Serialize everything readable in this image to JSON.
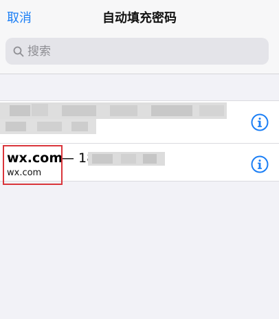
{
  "navbar": {
    "cancel_label": "取消",
    "title": "自动填充密码"
  },
  "search": {
    "placeholder": "搜索",
    "icon": "search-icon"
  },
  "accounts": [
    {
      "title": "",
      "subtitle": "",
      "redacted": true,
      "info_icon": "info-icon"
    },
    {
      "title": "wx.com",
      "separator": "— 18",
      "subtitle": "wx.com",
      "username_partially_redacted": true,
      "highlighted": true,
      "info_icon": "info-icon"
    }
  ],
  "colors": {
    "accent": "#1a7ef5",
    "background": "#f2f2f7",
    "highlight_box": "#d9343a"
  }
}
